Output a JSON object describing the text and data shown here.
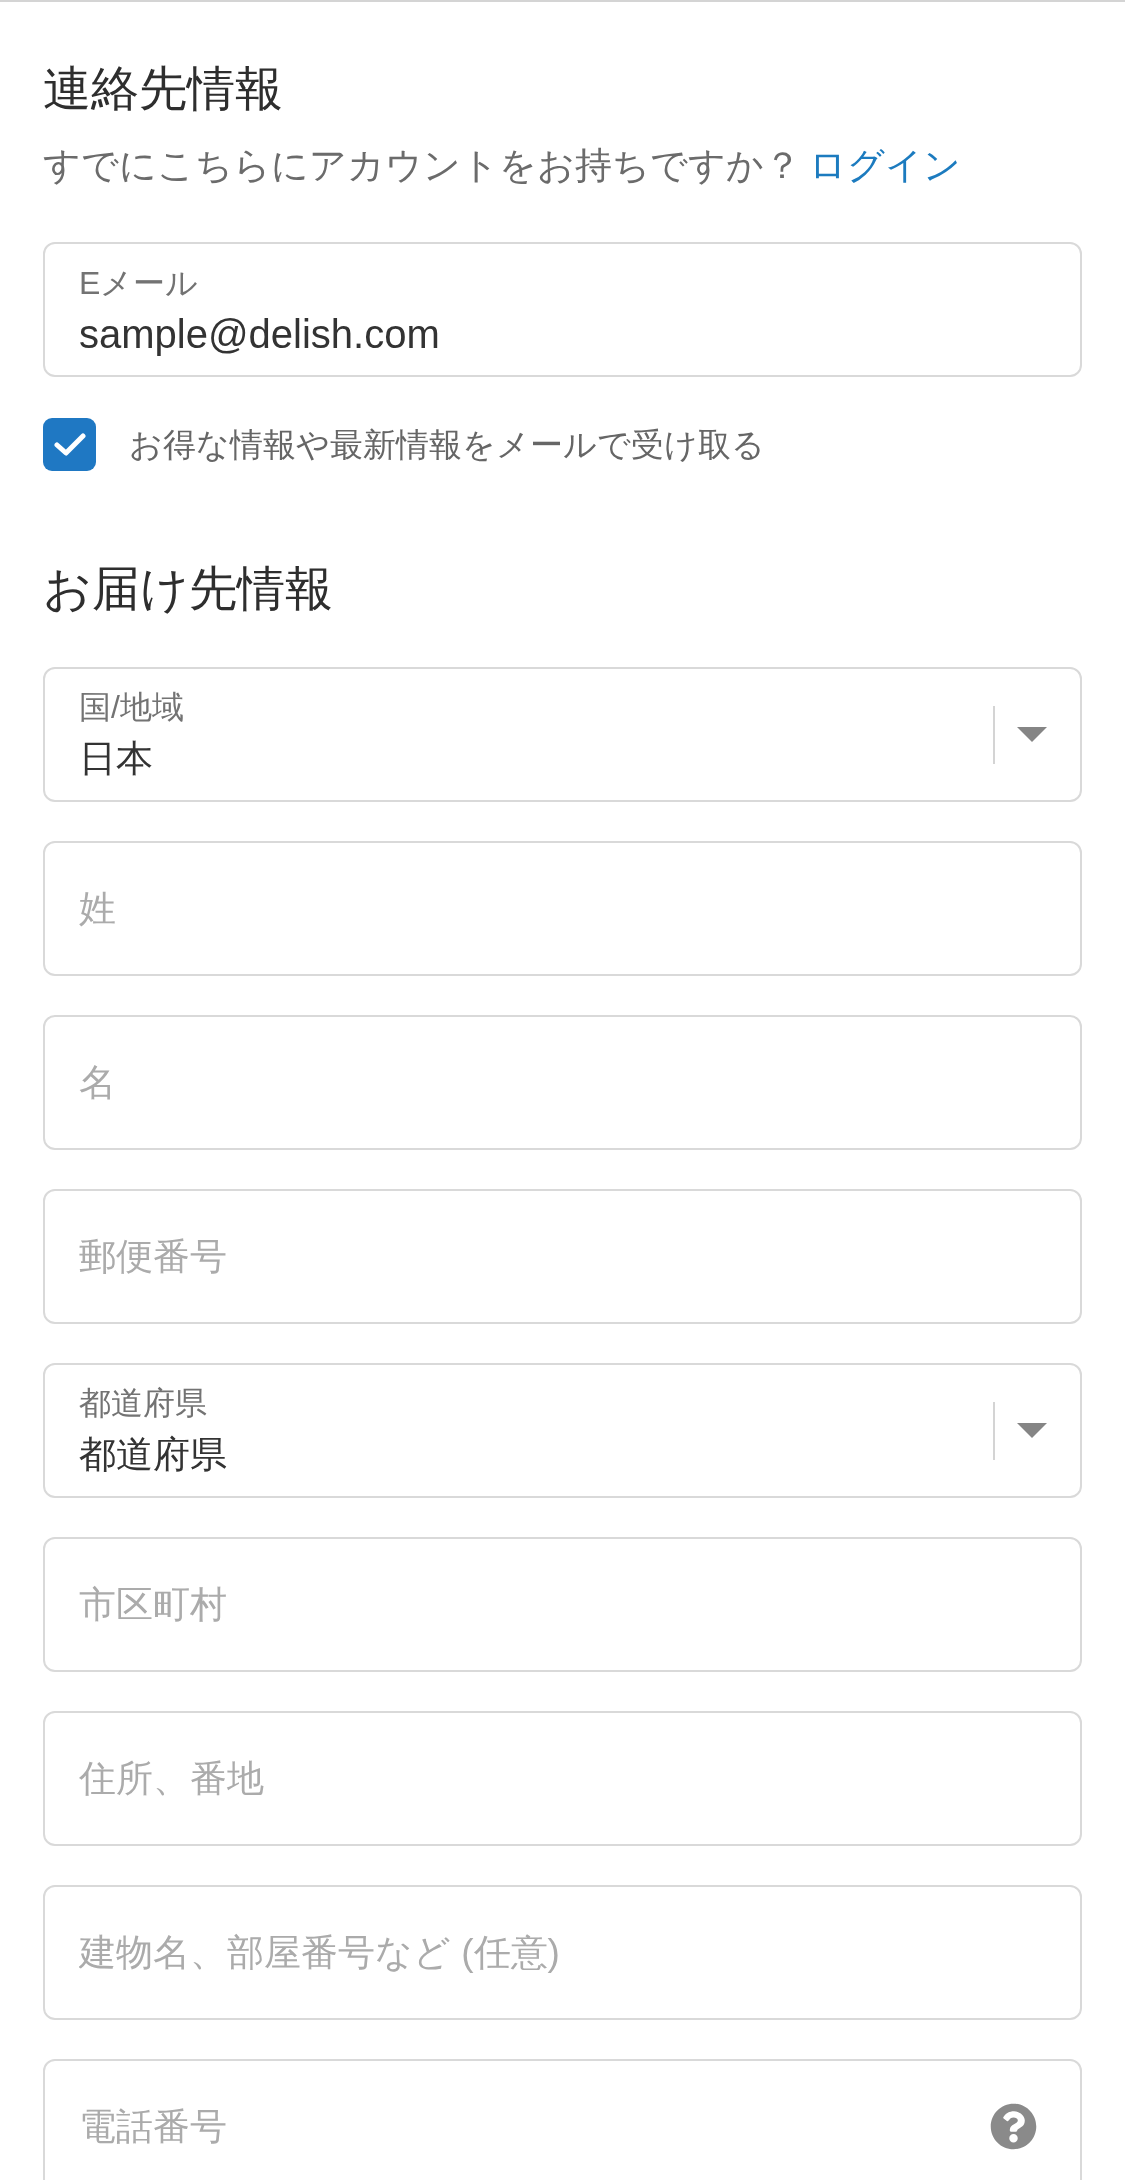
{
  "contact": {
    "title": "連絡先情報",
    "login_prompt": "すでにこちらにアカウントをお持ちですか？",
    "login_link": "ログイン",
    "email": {
      "label": "Eメール",
      "value": "sample@delish.com"
    },
    "newsletter": {
      "label": "お得な情報や最新情報をメールで受け取る",
      "checked": true
    }
  },
  "shipping": {
    "title": "お届け先情報",
    "fields": [
      {
        "kind": "select",
        "label": "国/地域",
        "value": "日本"
      },
      {
        "kind": "text",
        "placeholder": "姓"
      },
      {
        "kind": "text",
        "placeholder": "名"
      },
      {
        "kind": "text",
        "placeholder": "郵便番号"
      },
      {
        "kind": "select",
        "label": "都道府県",
        "value": "都道府県"
      },
      {
        "kind": "text",
        "placeholder": "市区町村"
      },
      {
        "kind": "text",
        "placeholder": "住所、番地"
      },
      {
        "kind": "text",
        "placeholder": "建物名、部屋番号など (任意)"
      },
      {
        "kind": "text",
        "placeholder": "電話番号",
        "help": true
      }
    ]
  }
}
